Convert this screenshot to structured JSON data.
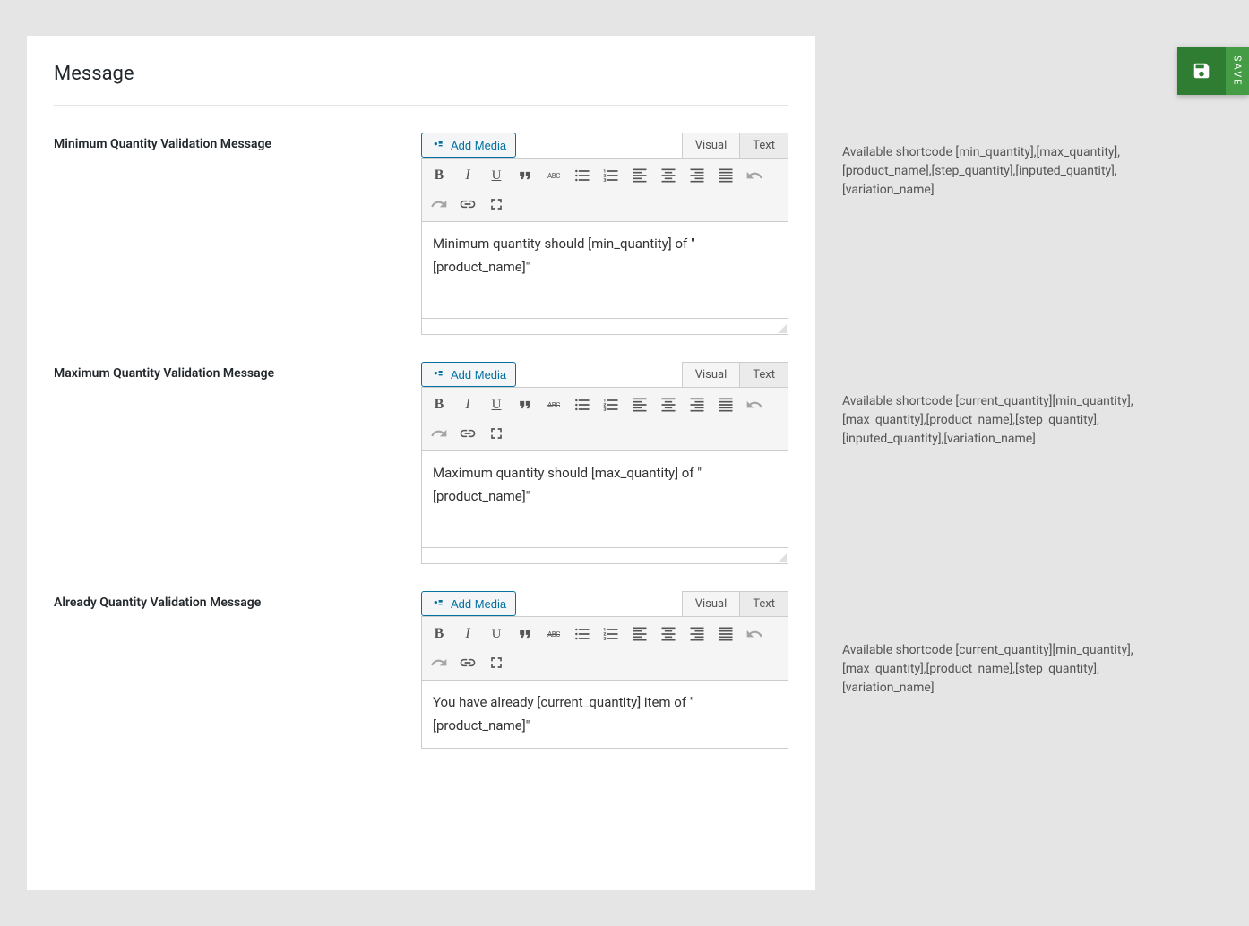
{
  "section_title": "Message",
  "save_button": {
    "label": "SAVE"
  },
  "editor_common": {
    "add_media_label": "Add Media",
    "tab_visual": "Visual",
    "tab_text": "Text",
    "tool_bold": "B",
    "tool_italic": "I",
    "tool_underline": "U",
    "tool_strike": "ABC"
  },
  "fields": {
    "min": {
      "label": "Minimum Quantity Validation Message",
      "content": "Minimum quantity should [min_quantity] of \"[product_name]\"",
      "shortcode_info": "Available shortcode [min_quantity],[max_quantity],[product_name],[step_quantity],[inputed_quantity],[variation_name]"
    },
    "max": {
      "label": "Maximum Quantity Validation Message",
      "content": "Maximum quantity should [max_quantity] of \"[product_name]\"",
      "shortcode_info": "Available shortcode [current_quantity][min_quantity],[max_quantity],[product_name],[step_quantity],[inputed_quantity],[variation_name]"
    },
    "already": {
      "label": "Already Quantity Validation Message",
      "content": "You have already [current_quantity] item of \"[product_name]\"",
      "shortcode_info": "Available shortcode [current_quantity][min_quantity],[max_quantity],[product_name],[step_quantity],[variation_name]"
    }
  }
}
